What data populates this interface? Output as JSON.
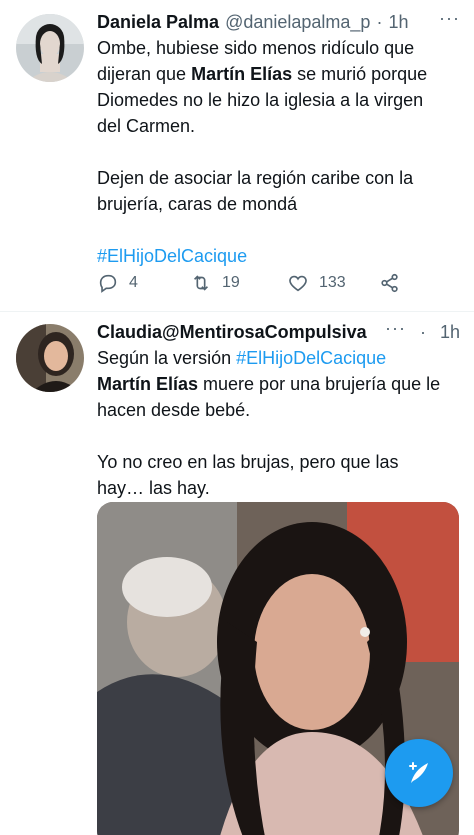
{
  "tweets": [
    {
      "display_name": "Daniela Palma",
      "handle": "@danielapalma_p",
      "separator": "·",
      "time": "1h",
      "more": "···",
      "lines": {
        "l1": "Ombe, hubiese sido menos ridículo que",
        "l2a": "dijeran que ",
        "l2b": "Martín Elías",
        "l2c": " se murió porque",
        "l3": "Diomedes no le hizo la iglesia a la virgen",
        "l4": "del Carmen.",
        "l5": "Dejen de asociar la región caribe con la",
        "l6": "brujería, caras de mondá",
        "hashtag": "#ElHijoDelCacique"
      },
      "stats": {
        "replies": "4",
        "retweets": "19",
        "likes": "133"
      },
      "icons": [
        "reply-icon",
        "retweet-icon",
        "like-icon",
        "share-icon"
      ]
    },
    {
      "display_name": "Claudia@MentirosaCompulsiva",
      "separator": "·",
      "time": "1h",
      "more": "···",
      "lines": {
        "l1a": "Según la versión ",
        "l1b": "#ElHijoDelCacique",
        "l2a": "Martín Elías",
        "l2b": " muere por una brujería que le",
        "l3": "hacen desde bebé.",
        "l4": "Yo no creo en las brujas, pero que las",
        "l5": "hay… las hay."
      }
    }
  ],
  "fab": {
    "icon": "compose-tweet-icon"
  },
  "colors": {
    "accent": "#1d9bf0",
    "secondary_text": "#536471",
    "primary_text": "#0f1419"
  }
}
